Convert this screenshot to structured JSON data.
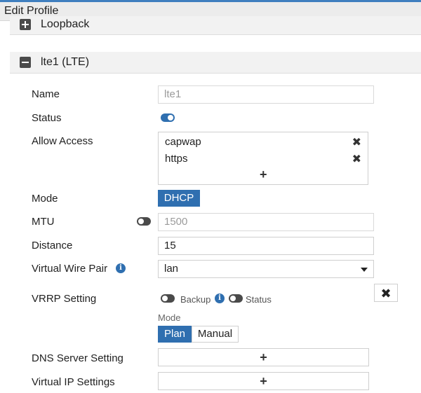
{
  "window": {
    "title": "Edit Profile"
  },
  "sections": {
    "loopback": {
      "label": "Loopback",
      "expanded": false
    },
    "lte": {
      "label": "lte1 (LTE)",
      "expanded": true
    }
  },
  "form": {
    "name": {
      "label": "Name",
      "value": "lte1"
    },
    "status": {
      "label": "Status",
      "enabled": true
    },
    "allow_access": {
      "label": "Allow Access",
      "items": [
        "capwap",
        "https"
      ],
      "add_glyph": "+",
      "remove_glyph": "✖"
    },
    "mode": {
      "label": "Mode",
      "value": "DHCP"
    },
    "mtu": {
      "label": "MTU",
      "override": false,
      "value": "1500"
    },
    "distance": {
      "label": "Distance",
      "value": "15"
    },
    "virtual_wire_pair": {
      "label": "Virtual Wire Pair",
      "value": "lan"
    },
    "vrrp": {
      "label": "VRRP Setting",
      "backup_label": "Backup",
      "status_label": "Status",
      "mode_label": "Mode",
      "mode_options": [
        "Plan",
        "Manual"
      ],
      "mode_selected": "Plan",
      "close_glyph": "✖"
    },
    "dns_server": {
      "label": "DNS Server Setting",
      "add_glyph": "+"
    },
    "virtual_ip": {
      "label": "Virtual IP Settings",
      "add_glyph": "+"
    }
  },
  "colors": {
    "accent": "#2f6fb0",
    "toggle_off": "#4a4a4a",
    "border": "#cfcfcf"
  },
  "icons": {
    "info": "i"
  }
}
